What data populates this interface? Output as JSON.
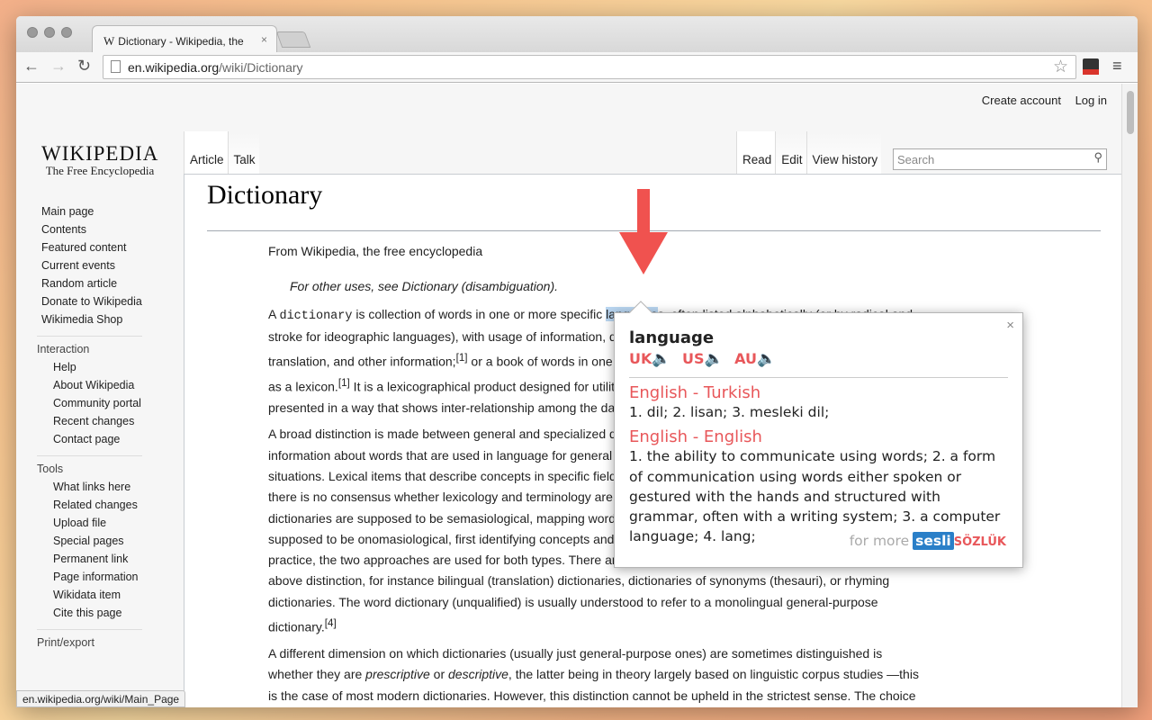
{
  "browser": {
    "tab_title": "Dictionary - Wikipedia, the",
    "tab_favicon": "W",
    "tab_close": "×",
    "url_host": "en.wikipedia.org",
    "url_path": "/wiki/Dictionary"
  },
  "wiki": {
    "user_links": [
      "Create account",
      "Log in"
    ],
    "logo_title": "WIKIPEDIA",
    "logo_subtitle": "The Free Encyclopedia",
    "nav_main": [
      "Main page",
      "Contents",
      "Featured content",
      "Current events",
      "Random article",
      "Donate to Wikipedia",
      "Wikimedia Shop"
    ],
    "interaction_heading": "Interaction",
    "nav_interaction": [
      "Help",
      "About Wikipedia",
      "Community portal",
      "Recent changes",
      "Contact page"
    ],
    "tools_heading": "Tools",
    "nav_tools": [
      "What links here",
      "Related changes",
      "Upload file",
      "Special pages",
      "Permanent link",
      "Page information",
      "Wikidata item",
      "Cite this page"
    ],
    "print_heading": "Print/export",
    "tabs_left": [
      "Article",
      "Talk"
    ],
    "tabs_right": [
      "Read",
      "Edit",
      "View history"
    ],
    "search_placeholder": "Search",
    "page_title": "Dictionary",
    "from": "From Wikipedia, the free encyclopedia",
    "hatnote": "For other uses, see Dictionary (disambiguation).",
    "status_url": "en.wikipedia.org/wiki/Main_Page"
  },
  "popup": {
    "word": "language",
    "close": "×",
    "accents": [
      "UK",
      "US",
      "AU"
    ],
    "sections": [
      {
        "heading": "English - Turkish",
        "text": "1. dil; 2. lisan; 3. mesleki dil;"
      },
      {
        "heading": "English - English",
        "text": "1. the ability to communicate using words; 2. a form of communication using words either spoken or gestured with the hands and structured with grammar, often with a writing system; 3. a computer language; 4. lang;"
      }
    ],
    "for_more": "for more",
    "brand_sesli": "sesli",
    "brand_sozluk": "SÖZLÜK"
  },
  "colors": {
    "accent_red": "#e8575a",
    "brand_blue": "#2a7fc8",
    "highlight": "#b9d6f1"
  }
}
